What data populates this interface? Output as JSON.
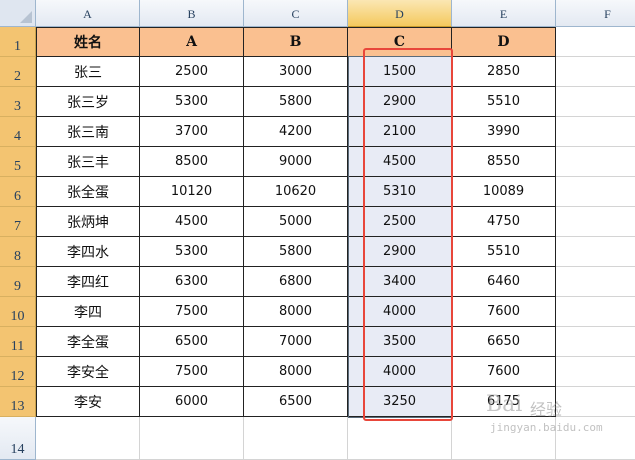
{
  "columns": [
    "A",
    "B",
    "C",
    "D",
    "E",
    "F"
  ],
  "rows": [
    "1",
    "2",
    "3",
    "4",
    "5",
    "6",
    "7",
    "8",
    "9",
    "10",
    "11",
    "12",
    "13",
    "14"
  ],
  "selected_column": "D",
  "table": {
    "headers": [
      "姓名",
      "A",
      "B",
      "C",
      "D"
    ],
    "data": [
      [
        "张三",
        "2500",
        "3000",
        "1500",
        "2850"
      ],
      [
        "张三岁",
        "5300",
        "5800",
        "2900",
        "5510"
      ],
      [
        "张三南",
        "3700",
        "4200",
        "2100",
        "3990"
      ],
      [
        "张三丰",
        "8500",
        "9000",
        "4500",
        "8550"
      ],
      [
        "张全蛋",
        "10120",
        "10620",
        "5310",
        "10089"
      ],
      [
        "张炳坤",
        "4500",
        "5000",
        "2500",
        "4750"
      ],
      [
        "李四水",
        "5300",
        "5800",
        "2900",
        "5510"
      ],
      [
        "李四红",
        "6300",
        "6800",
        "3400",
        "6460"
      ],
      [
        "李四",
        "7500",
        "8000",
        "4000",
        "7600"
      ],
      [
        "李全蛋",
        "6500",
        "7000",
        "3500",
        "6650"
      ],
      [
        "李安全",
        "7500",
        "8000",
        "4000",
        "7600"
      ],
      [
        "李安",
        "6000",
        "6500",
        "3250",
        "6175"
      ]
    ]
  },
  "watermark": {
    "logo": "Bai",
    "text": "经验",
    "url": "jingyan.baidu.com"
  },
  "colors": {
    "header_fill": "#fac090",
    "row_header_highlight": "#f3c471",
    "selection_fill": "#e8ebf5",
    "annotation_red": "#e8463a"
  }
}
